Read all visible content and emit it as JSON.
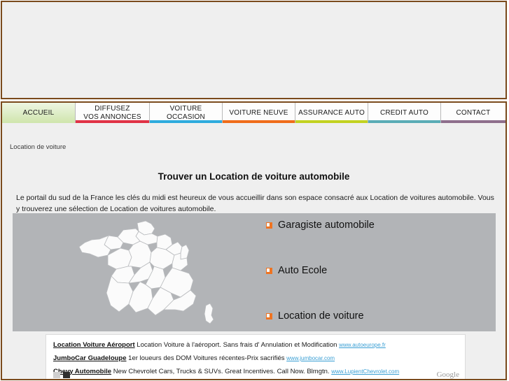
{
  "site": {
    "banner_alt": "banner-placeholder"
  },
  "nav": {
    "items": [
      {
        "label": "ACCUEIL",
        "label2": "",
        "accent": "#cfe5ac",
        "active": true
      },
      {
        "label": "DIFFUSEZ",
        "label2": "VOS ANNONCES",
        "accent": "#e03246",
        "active": false
      },
      {
        "label": "VOITURE OCCASION",
        "label2": "",
        "accent": "#2eabdd",
        "active": false
      },
      {
        "label": "VOITURE NEUVE",
        "label2": "",
        "accent": "#ef6c1a",
        "active": false
      },
      {
        "label": "ASSURANCE AUTO",
        "label2": "",
        "accent": "#c2d221",
        "active": false
      },
      {
        "label": "CREDIT AUTO",
        "label2": "",
        "accent": "#5aacb6",
        "active": false
      },
      {
        "label": "CONTACT",
        "label2": "",
        "accent": "#8e6e8c",
        "active": false
      }
    ]
  },
  "breadcrumb": {
    "text": "Location de voiture"
  },
  "main": {
    "title": "Trouver un Location de voiture automobile",
    "intro": "Le portail du sud de la France les clés du midi est heureux de vous accueillir dans son espace consacré aux Location de voitures automobile. Vous y trouverez une sélection de Location de voitures automobile."
  },
  "panel": {
    "map_name": "france-regions-map",
    "links": [
      {
        "label": "Garagiste automobile"
      },
      {
        "label": "Auto Ecole"
      },
      {
        "label": "Location de voiture"
      }
    ],
    "bullet_color": "#ef7421",
    "background": "#b2b4b7"
  },
  "ads": {
    "items": [
      {
        "title": "Location Voiture Aéroport",
        "desc": "Location Voiture à l'aéroport. Sans frais d' Annulation et Modification",
        "url": "www.autoeurope.fr"
      },
      {
        "title": "JumboCar Guadeloupe",
        "desc": "1er loueurs des DOM Voitures récentes-Prix sacrifiés",
        "url": "www.jumbocar.com"
      },
      {
        "title": "Chevy Automobile",
        "desc": "New Chevrolet Cars, Trucks & SUVs. Great Incentives. Call Now. Blmgtn.",
        "url": "www.LupientChevrolet.com"
      }
    ],
    "brand": "Google"
  },
  "colors": {
    "frame": "#7a4a1c",
    "page_bg": "#efefef",
    "link_blue": "#3a9fd4"
  }
}
